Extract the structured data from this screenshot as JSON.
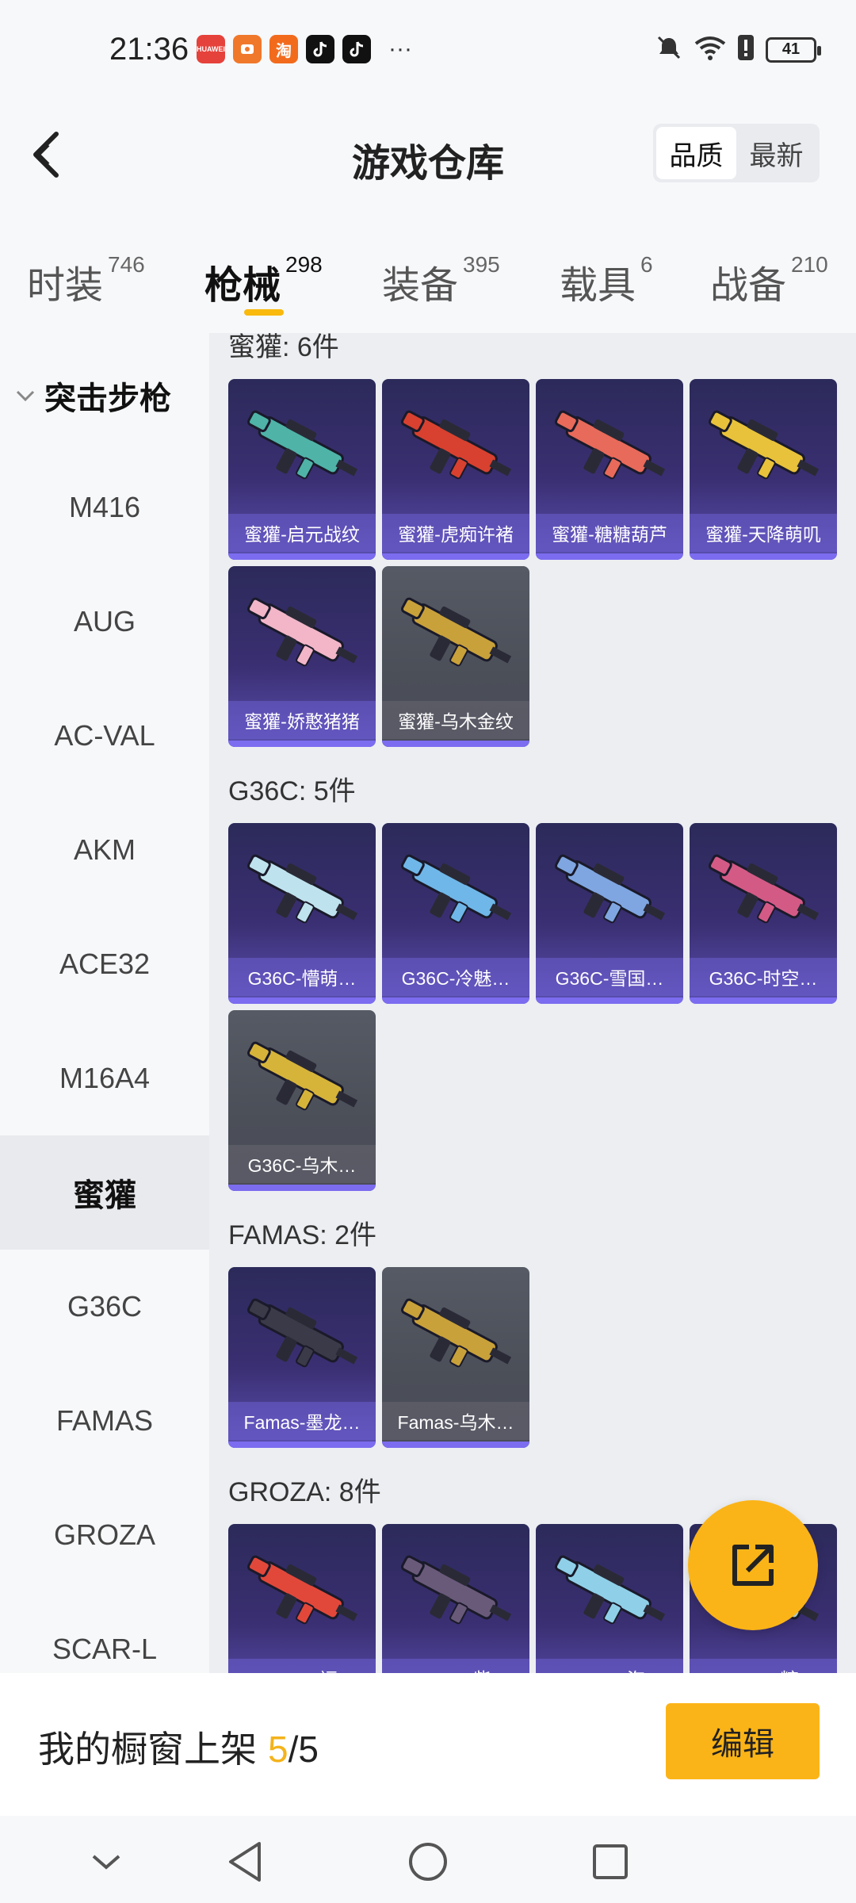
{
  "status_bar": {
    "time": "21:36",
    "apps": [
      {
        "name": "huawei-app-icon",
        "text": "HUAWEI",
        "color": "#e5423b"
      },
      {
        "name": "store-app-icon",
        "text": "",
        "color": "#f0782a"
      },
      {
        "name": "taobao-app-icon",
        "text": "淘",
        "color": "#f26b1d"
      },
      {
        "name": "tiktok-app-icon",
        "text": "",
        "color": "#111111"
      },
      {
        "name": "tiktok-app-icon",
        "text": "",
        "color": "#111111"
      }
    ],
    "more": "···",
    "battery": "41"
  },
  "header": {
    "title": "游戏仓库",
    "sort_options": [
      "品质",
      "最新"
    ],
    "sort_active": "品质"
  },
  "tabs": [
    {
      "label": "时装",
      "count": "746"
    },
    {
      "label": "枪械",
      "count": "298",
      "active": true
    },
    {
      "label": "装备",
      "count": "395"
    },
    {
      "label": "载具",
      "count": "6"
    },
    {
      "label": "战备",
      "count": "210"
    }
  ],
  "sidebar": {
    "category": "突击步枪",
    "items": [
      "M416",
      "AUG",
      "AC-VAL",
      "AKM",
      "ACE32",
      "M16A4",
      "蜜獾",
      "G36C",
      "FAMAS",
      "GROZA",
      "SCAR-L"
    ],
    "active": "蜜獾"
  },
  "groups": [
    {
      "title": "蜜獾: 6件",
      "items": [
        {
          "label": "蜜獾-启元战纹",
          "grey": false,
          "color": "#4fb3a8"
        },
        {
          "label": "蜜獾-虎痴许褚",
          "grey": false,
          "color": "#d8412f"
        },
        {
          "label": "蜜獾-糖糖葫芦",
          "grey": false,
          "color": "#e86a5a"
        },
        {
          "label": "蜜獾-天降萌叽",
          "grey": false,
          "color": "#e8c23a"
        },
        {
          "label": "蜜獾-娇憨猪猪",
          "grey": false,
          "color": "#f2b6c8"
        },
        {
          "label": "蜜獾-乌木金纹",
          "grey": true,
          "color": "#c9a13a"
        }
      ]
    },
    {
      "title": "G36C: 5件",
      "items": [
        {
          "label": "G36C-懵萌…",
          "grey": false,
          "color": "#bfe3ee"
        },
        {
          "label": "G36C-冷魅…",
          "grey": false,
          "color": "#6fb7e8"
        },
        {
          "label": "G36C-雪国…",
          "grey": false,
          "color": "#7fa6e0"
        },
        {
          "label": "G36C-时空…",
          "grey": false,
          "color": "#d45a86"
        },
        {
          "label": "G36C-乌木…",
          "grey": true,
          "color": "#d6b43a"
        }
      ]
    },
    {
      "title": "FAMAS: 2件",
      "items": [
        {
          "label": "Famas-墨龙…",
          "grey": false,
          "color": "#3a3a48"
        },
        {
          "label": "Famas-乌木…",
          "grey": true,
          "color": "#c9a13a"
        }
      ]
    },
    {
      "title": "GROZA: 8件",
      "items": [
        {
          "label": "GROZA-福…",
          "grey": false,
          "color": "#e2483a"
        },
        {
          "label": "GROZA-紫…",
          "grey": false,
          "color": "#6a5a7a"
        },
        {
          "label": "GROZA-海…",
          "grey": false,
          "color": "#8fd0e8"
        },
        {
          "label": "GROZA-糖…",
          "grey": false,
          "color": "#b8dde8"
        }
      ]
    }
  ],
  "bottom_bar": {
    "shelf_label": "我的橱窗上架",
    "shelf_current": "5",
    "shelf_sep": "/5",
    "edit_label": "编辑"
  },
  "colors": {
    "accent": "#fbb417",
    "card_purple": "#3a2f72",
    "card_grey": "#4b4f58"
  }
}
